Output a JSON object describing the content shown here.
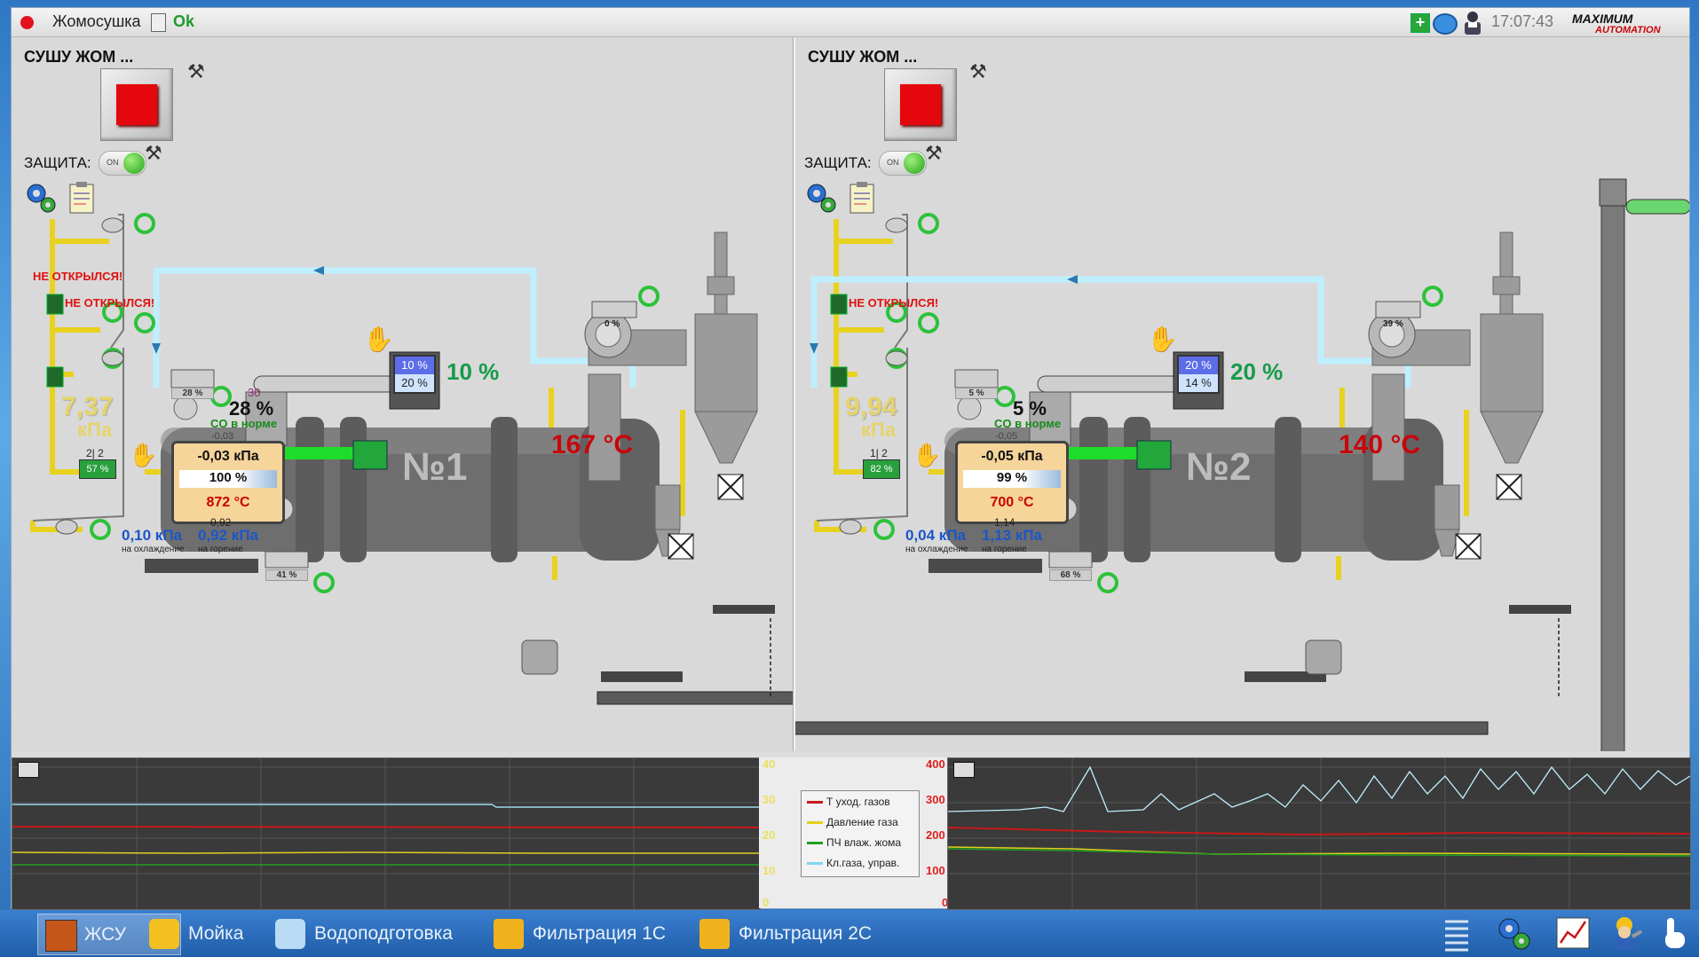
{
  "window": {
    "app_title": "Жомосушка",
    "status_ok": "Ok",
    "clock": "17:07:43",
    "logo_text_top": "MAXIMUM",
    "logo_text_bottom": "AUTOMATION"
  },
  "panels": [
    {
      "title": "СУШУ ЖОМ ...",
      "protection_label": "ЗАЩИТА:",
      "toggle_text": "ON",
      "warning_1": "НЕ ОТКРЫЛСЯ!",
      "warning_2": "НЕ ОТКРЫЛСЯ!",
      "gas_pressure_value": "7,37",
      "gas_pressure_unit": "кПа",
      "valve_ratio": "2| 2",
      "valve_pct": "57 %",
      "fan_small_pct": "28 %",
      "co_value": "28 %",
      "co_small": "30",
      "co_status": "CO в норме",
      "burner_small": "-0,03",
      "burner_pressure": "-0,03 кПа",
      "burner_power": "100 %",
      "burner_temp": "872 °C",
      "drum_label": "№1",
      "exhaust_temp": "167 °C",
      "feeder_pct_top": "10 %",
      "feeder_pct_bottom": "20 %",
      "moisture": "10 %",
      "cyclone_fan_pct": "0 %",
      "cooling_pressure": "0,10 кПа",
      "cooling_label": "на охлаждение",
      "burning_small": "0,92",
      "burning_pressure": "0,92 кПа",
      "burning_label": "на горение",
      "air_fan_pct": "41 %"
    },
    {
      "title": "СУШУ ЖОМ ...",
      "protection_label": "ЗАЩИТА:",
      "toggle_text": "ON",
      "warning_1": "НЕ ОТКРЫЛСЯ!",
      "gas_pressure_value": "9,94",
      "gas_pressure_unit": "кПа",
      "valve_ratio": "1| 2",
      "valve_pct": "82 %",
      "fan_small_pct": "5 %",
      "co_value": "5 %",
      "co_status": "CO в норме",
      "burner_small": "-0,05",
      "burner_pressure": "-0,05 кПа",
      "burner_power": "99 %",
      "burner_temp": "700 °C",
      "drum_label": "№2",
      "exhaust_temp": "140 °C",
      "feeder_pct_top": "20 %",
      "feeder_pct_bottom": "14 %",
      "moisture": "20 %",
      "cyclone_fan_pct": "39 %",
      "cooling_pressure": "0,04 кПа",
      "cooling_label": "на охлаждение",
      "burning_small": "1,14",
      "burning_pressure": "1,13 кПа",
      "burning_label": "на горение",
      "air_fan_pct": "68 %"
    }
  ],
  "trend": {
    "left_axis_ticks": [
      "40",
      "30",
      "20",
      "10",
      "0"
    ],
    "right_axis_ticks": [
      "400",
      "300",
      "200",
      "100",
      "0"
    ],
    "left_axis_color": "#e8e060",
    "right_axis_color": "#e02020",
    "legend": [
      {
        "label": "Т уход. газов",
        "color": "#c81818"
      },
      {
        "label": "Давление газа",
        "color": "#e0d020"
      },
      {
        "label": "ПЧ влаж. жома",
        "color": "#20a020"
      },
      {
        "label": "Кл.газа, управ.",
        "color": "#7fd8ef"
      }
    ]
  },
  "taskbar": {
    "items": [
      {
        "label": "ЖСУ",
        "active": true
      },
      {
        "label": "Мойка",
        "active": false
      },
      {
        "label": "Водоподготовка",
        "active": false
      },
      {
        "label": "Фильтрация 1С",
        "active": false
      },
      {
        "label": "Фильтрация 2С",
        "active": false
      }
    ]
  }
}
